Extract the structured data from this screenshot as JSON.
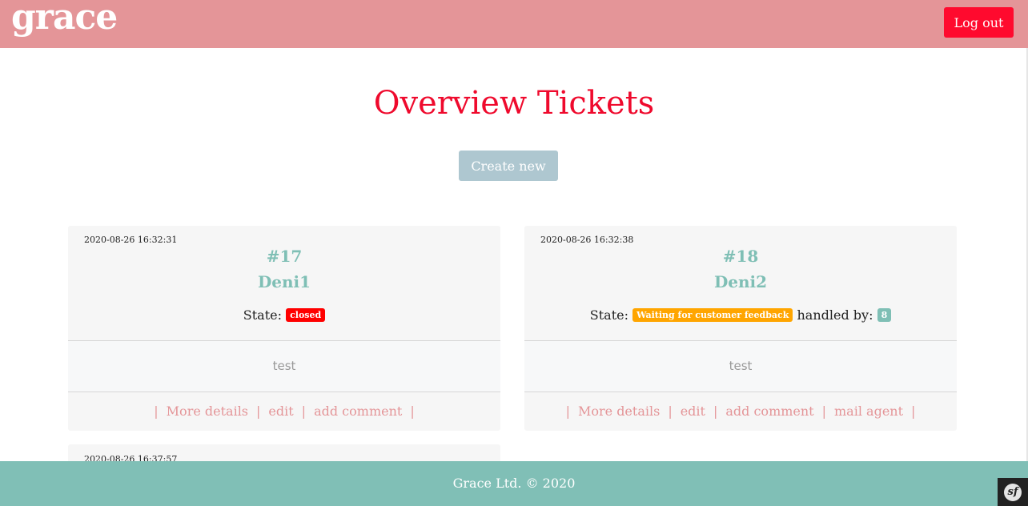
{
  "navbar": {
    "brand": "grace",
    "logout_label": "Log out",
    "bg_color": "#e49598",
    "logout_color": "#ff0a2e"
  },
  "main": {
    "title": "Overview Tickets",
    "create_label": "Create new"
  },
  "tickets": [
    {
      "timestamp": "2020-08-26 16:32:31",
      "number": "#17",
      "author": "Deni1",
      "state_label": "State:",
      "state": "closed",
      "state_color": "#ff0000",
      "description": "test",
      "links": [
        "More details",
        "edit",
        "add comment"
      ]
    },
    {
      "timestamp": "2020-08-26 16:32:38",
      "number": "#18",
      "author": "Deni2",
      "state_label": "State:",
      "state": "Waiting for customer feedback",
      "state_color": "#ffa500",
      "handled_label": "handled by:",
      "handler": "8",
      "handler_color": "#7fbfb5",
      "description": "test",
      "links": [
        "More details",
        "edit",
        "add comment",
        "mail agent"
      ]
    },
    {
      "timestamp": "2020-08-26 16:37:57"
    }
  ],
  "footer": {
    "text": "Grace Ltd. © 2020",
    "bg_color": "#80bfb6"
  },
  "debug_toolbar": {
    "icon": "symfony-icon",
    "glyph": "sf"
  }
}
